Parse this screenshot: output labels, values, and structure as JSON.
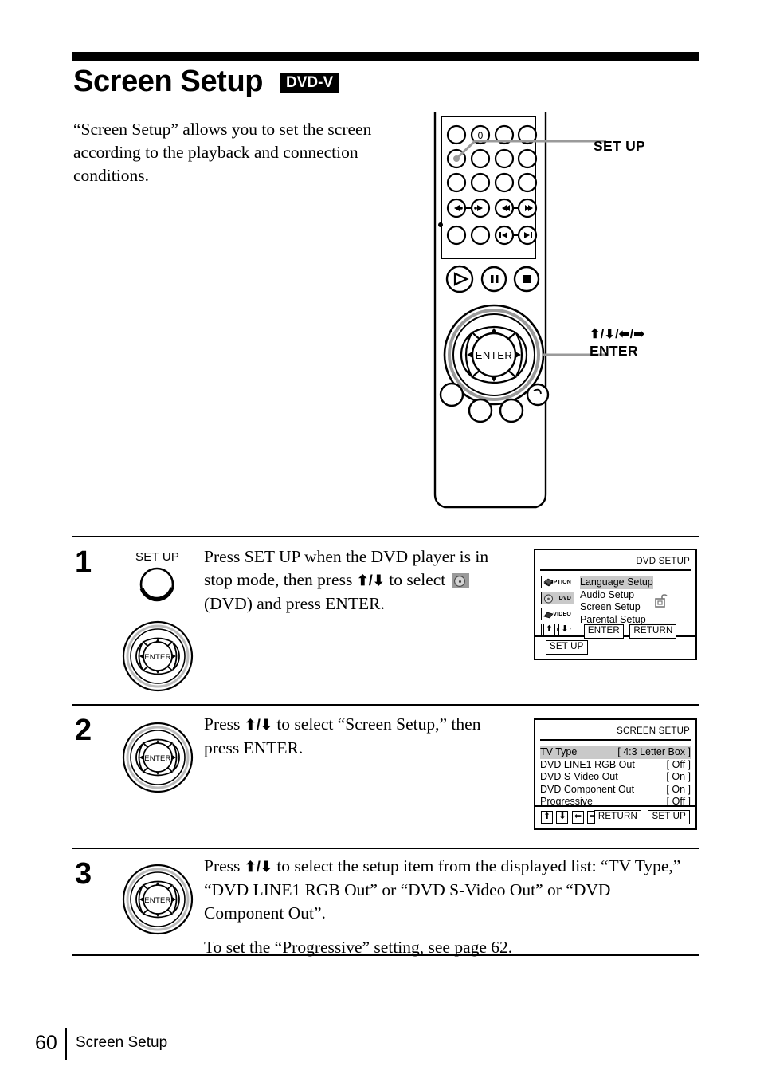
{
  "header": {
    "title": "Screen Setup",
    "disc_badge": "DVD-V"
  },
  "intro": {
    "text": "“Screen Setup” allows you to set the screen according to the playback and connection conditions."
  },
  "remote_figure": {
    "callout_setup": "SET UP",
    "callout_arrows": "⬆/⬇/⬅/➡",
    "callout_enter": "ENTER",
    "enter_button_label": "ENTER"
  },
  "steps": [
    {
      "number": "1",
      "button_label": "SET UP",
      "text_part1": "Press SET UP when the DVD player is in stop mode, then press ",
      "arrows": "⬆/⬇",
      "text_part2": " to select ",
      "text_part3": " (DVD) and press ENTER.",
      "enter_label": "ENTER"
    },
    {
      "number": "2",
      "text_part1": "Press ",
      "arrows": "⬆/⬇",
      "text_part2": " to select “Screen Setup,” then press ENTER.",
      "enter_label": "ENTER"
    },
    {
      "number": "3",
      "text_part1": "Press ",
      "arrows": "⬆/⬇",
      "text_part2": " to select the setup item from the displayed list: “TV Type,” “DVD LINE1 RGB Out” or “DVD S-Video Out” or “DVD Component Out”.",
      "text_part3": "To set the “Progressive” setting, see page 62.",
      "enter_label": "ENTER"
    }
  ],
  "osd_dvd_setup": {
    "title": "DVD SETUP",
    "sources": [
      {
        "label": "OPTION",
        "icon": "option-icon",
        "active": false
      },
      {
        "label": "DVD",
        "icon": "dvd-disc-icon",
        "active": true
      },
      {
        "label": "VIDEO",
        "icon": "video-cassette-icon",
        "active": false
      },
      {
        "label": "TIMER",
        "icon": "timer-clock-icon",
        "active": false
      }
    ],
    "menu_items": [
      {
        "label": "Language Setup",
        "selected": true
      },
      {
        "label": "Audio Setup",
        "selected": false
      },
      {
        "label": "Screen Setup",
        "selected": false
      },
      {
        "label": "Parental Setup",
        "selected": false
      }
    ],
    "parental_icon": "lock-open-icon",
    "footer_arrows": [
      "⬆",
      "⬇"
    ],
    "footer_keys": [
      "ENTER",
      "RETURN",
      "SET UP"
    ]
  },
  "osd_screen_setup": {
    "title": "SCREEN SETUP",
    "rows": [
      {
        "label": "TV Type",
        "value": "[ 4:3 Letter Box ]",
        "selected": true
      },
      {
        "label": "DVD LINE1 RGB Out",
        "value": "[ Off ]",
        "selected": false
      },
      {
        "label": "DVD S-Video Out",
        "value": "[ On ]",
        "selected": false
      },
      {
        "label": "DVD Component Out",
        "value": "[ On ]",
        "selected": false
      },
      {
        "label": "Progressive",
        "value": "[ Off ]",
        "selected": false
      }
    ],
    "footer_arrows": [
      "⬆",
      "⬇",
      "⬅",
      "➡"
    ],
    "footer_keys": [
      "RETURN",
      "SET UP"
    ]
  },
  "footer": {
    "page_number": "60",
    "section": "Screen Setup"
  }
}
